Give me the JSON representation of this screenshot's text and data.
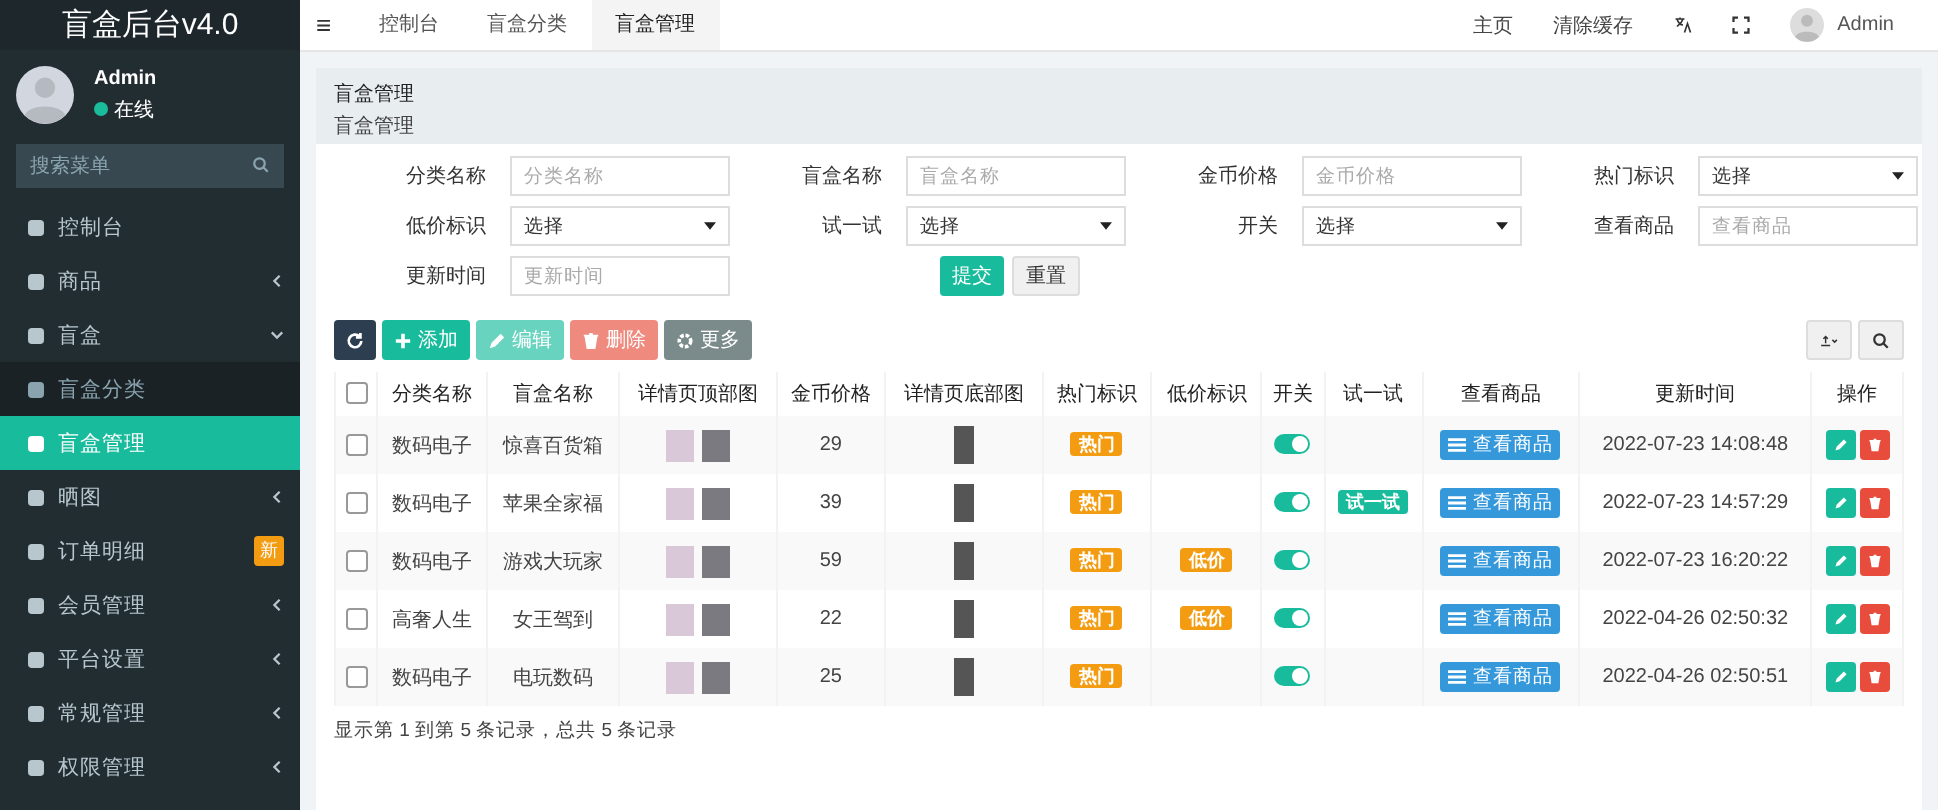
{
  "sidebar": {
    "logo": "盲盒后台v4.0",
    "user": {
      "name": "Admin",
      "status": "在线"
    },
    "search": {
      "placeholder": "搜索菜单"
    },
    "items": [
      {
        "kind": "link",
        "label": "控制台",
        "selected": false
      },
      {
        "kind": "group",
        "label": "商品",
        "expanded": false,
        "selected": false
      },
      {
        "kind": "group",
        "label": "盲盒",
        "expanded": true,
        "selected": false,
        "children": [
          {
            "label": "盲盒分类",
            "selected": false
          },
          {
            "label": "盲盒管理",
            "selected": true
          }
        ]
      },
      {
        "kind": "group",
        "label": "晒图",
        "expanded": false,
        "selected": false
      },
      {
        "kind": "link",
        "label": "订单明细",
        "badge": "新",
        "selected": false
      },
      {
        "kind": "group",
        "label": "会员管理",
        "expanded": false,
        "selected": false
      },
      {
        "kind": "group",
        "label": "平台设置",
        "expanded": false,
        "selected": false
      },
      {
        "kind": "group",
        "label": "常规管理",
        "expanded": false,
        "selected": false
      },
      {
        "kind": "group",
        "label": "权限管理",
        "expanded": false,
        "selected": false
      }
    ]
  },
  "topbar": {
    "menu_toggle": "≡",
    "tabs": [
      {
        "label": "控制台",
        "selected": false
      },
      {
        "label": "盲盒分类",
        "selected": false
      },
      {
        "label": "盲盒管理",
        "selected": true
      }
    ],
    "links": [
      "主页",
      "清除缓存"
    ],
    "user": "Admin"
  },
  "header": {
    "title": "盲盒管理",
    "subtitle": "盲盒管理"
  },
  "filters": [
    {
      "kind": "input",
      "label": "分类名称",
      "placeholder": "分类名称"
    },
    {
      "kind": "input",
      "label": "盲盒名称",
      "placeholder": "盲盒名称"
    },
    {
      "kind": "input",
      "label": "金币价格",
      "placeholder": "金币价格"
    },
    {
      "kind": "select",
      "label": "热门标识",
      "value": "选择"
    },
    {
      "kind": "select",
      "label": "低价标识",
      "value": "选择"
    },
    {
      "kind": "select",
      "label": "试一试",
      "value": "选择"
    },
    {
      "kind": "select",
      "label": "开关",
      "value": "选择"
    },
    {
      "kind": "input",
      "label": "查看商品",
      "placeholder": "查看商品"
    },
    {
      "kind": "input",
      "label": "更新时间",
      "placeholder": "更新时间"
    }
  ],
  "filter_buttons": [
    "提交",
    "重置"
  ],
  "toolbar": [
    {
      "kind": "refresh",
      "disabled": false
    },
    {
      "kind": "add",
      "label": "添加",
      "disabled": false
    },
    {
      "kind": "edit",
      "label": "编辑",
      "disabled": true
    },
    {
      "kind": "delete",
      "label": "删除",
      "disabled": true
    },
    {
      "kind": "more",
      "label": "更多",
      "disabled": false
    }
  ],
  "table": {
    "select_all_checked": false,
    "columns": [
      "分类名称",
      "盲盒名称",
      "详情页顶部图",
      "金币价格",
      "详情页底部图",
      "热门标识",
      "低价标识",
      "开关",
      "试一试",
      "查看商品",
      "更新时间",
      "操作"
    ],
    "rows": [
      {
        "checked": false,
        "category": "数码电子",
        "name": "惊喜百货箱",
        "price": "29",
        "hot": "热门",
        "low": null,
        "on": true,
        "try": null,
        "view": "查看商品",
        "time": "2022-07-23 14:08:48"
      },
      {
        "checked": false,
        "category": "数码电子",
        "name": "苹果全家福",
        "price": "39",
        "hot": "热门",
        "low": null,
        "on": true,
        "try": "试一试",
        "view": "查看商品",
        "time": "2022-07-23 14:57:29"
      },
      {
        "checked": false,
        "category": "数码电子",
        "name": "游戏大玩家",
        "price": "59",
        "hot": "热门",
        "low": "低价",
        "on": true,
        "try": null,
        "view": "查看商品",
        "time": "2022-07-23 16:20:22"
      },
      {
        "checked": false,
        "category": "高奢人生",
        "name": "女王驾到",
        "price": "22",
        "hot": "热门",
        "low": "低价",
        "on": true,
        "try": null,
        "view": "查看商品",
        "time": "2022-04-26 02:50:32"
      },
      {
        "checked": false,
        "category": "数码电子",
        "name": "电玩数码",
        "price": "25",
        "hot": "热门",
        "low": null,
        "on": true,
        "try": null,
        "view": "查看商品",
        "time": "2022-04-26 02:50:51"
      }
    ]
  },
  "footer": "显示第 1 到第 5 条记录，总共 5 条记录"
}
